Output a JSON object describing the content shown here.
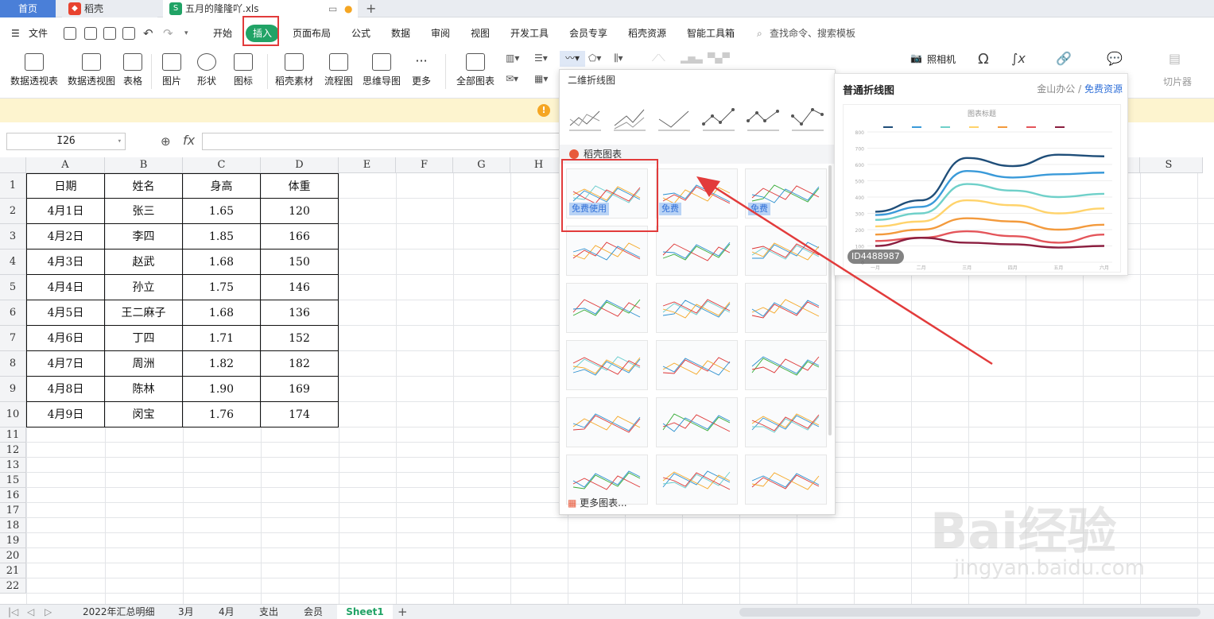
{
  "tabs": {
    "home": "首页",
    "daoke": "稻壳",
    "file": "五月的隆隆吖.xls"
  },
  "menu": {
    "file": "文件",
    "items": [
      "开始",
      "插入",
      "页面布局",
      "公式",
      "数据",
      "审阅",
      "视图",
      "开发工具",
      "会员专享",
      "稻壳资源",
      "智能工具箱"
    ],
    "search": "查找命令、搜索模板"
  },
  "ribbon": {
    "buttons": [
      "数据透视表",
      "数据透视图",
      "表格",
      "图片",
      "形状",
      "图标",
      "稻壳素材",
      "流程图",
      "思维导图",
      "更多",
      "全部图表"
    ],
    "right_small": [
      "照相机",
      "切片器"
    ]
  },
  "formula": {
    "cell_ref": "I26",
    "fx": "fx"
  },
  "grid": {
    "columns": [
      "A",
      "B",
      "C",
      "D",
      "E",
      "F",
      "G",
      "H",
      "S"
    ],
    "rows": [
      "1",
      "2",
      "3",
      "4",
      "5",
      "6",
      "7",
      "8",
      "9",
      "10",
      "11",
      "12",
      "13",
      "15",
      "16",
      "17",
      "18",
      "19",
      "20",
      "21",
      "22"
    ],
    "header": [
      "日期",
      "姓名",
      "身高",
      "体重"
    ],
    "data": [
      [
        "4月1日",
        "张三",
        "1.65",
        "120"
      ],
      [
        "4月2日",
        "李四",
        "1.85",
        "166"
      ],
      [
        "4月3日",
        "赵武",
        "1.68",
        "150"
      ],
      [
        "4月4日",
        "孙立",
        "1.75",
        "146"
      ],
      [
        "4月5日",
        "王二麻子",
        "1.68",
        "136"
      ],
      [
        "4月6日",
        "丁四",
        "1.71",
        "152"
      ],
      [
        "4月7日",
        "周洲",
        "1.82",
        "182"
      ],
      [
        "4月8日",
        "陈林",
        "1.90",
        "169"
      ],
      [
        "4月9日",
        "闵宝",
        "1.76",
        "174"
      ]
    ]
  },
  "dropdown": {
    "section1": "二维折线图",
    "section2": "稻壳图表",
    "free1": "免费使用",
    "free": "免费",
    "more": "更多图表..."
  },
  "preview": {
    "title": "普通折线图",
    "link_a": "金山办公",
    "link_sep": "/",
    "link_b": "免费资源",
    "id": "ID4488987",
    "chart_title": "图表标题"
  },
  "chart_data": {
    "type": "line",
    "title": "图表标题",
    "xlabel": "",
    "ylabel": "",
    "ylim": [
      0,
      800
    ],
    "categories": [
      "一月",
      "二月",
      "三月",
      "四月",
      "五月",
      "六月"
    ],
    "series": [
      {
        "name": "",
        "color": "#1f4e79",
        "values": [
          310,
          380,
          640,
          590,
          660,
          650
        ]
      },
      {
        "name": "",
        "color": "#3a9ad9",
        "values": [
          290,
          340,
          560,
          520,
          540,
          550
        ]
      },
      {
        "name": "",
        "color": "#6fd0c9",
        "values": [
          260,
          300,
          480,
          440,
          400,
          420
        ]
      },
      {
        "name": "",
        "color": "#ffd36b",
        "values": [
          220,
          250,
          380,
          350,
          300,
          330
        ]
      },
      {
        "name": "",
        "color": "#f39a3c",
        "values": [
          170,
          200,
          270,
          250,
          200,
          230
        ]
      },
      {
        "name": "",
        "color": "#e4555a",
        "values": [
          130,
          150,
          190,
          160,
          120,
          170
        ]
      },
      {
        "name": "",
        "color": "#8b1e3f",
        "values": [
          100,
          150,
          120,
          110,
          90,
          100
        ]
      }
    ]
  },
  "sheets": {
    "items": [
      "2022年汇总明细",
      "3月",
      "4月",
      "支出",
      "会员",
      "Sheet1"
    ],
    "add": "+"
  },
  "watermark": {
    "main": "Bai经验",
    "sub": "jingyan.baidu.com"
  }
}
